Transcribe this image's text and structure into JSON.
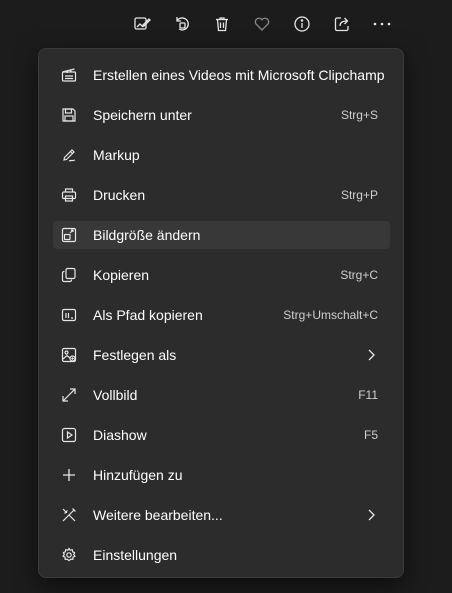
{
  "toolbar": {
    "buttons": [
      {
        "name": "edit-image-icon"
      },
      {
        "name": "rotate-icon"
      },
      {
        "name": "delete-icon"
      },
      {
        "name": "favorite-heart-icon"
      },
      {
        "name": "info-icon"
      },
      {
        "name": "share-icon"
      },
      {
        "name": "more-options-icon"
      }
    ]
  },
  "menu": {
    "items": [
      {
        "label": "Erstellen eines Videos mit Microsoft Clipchamp",
        "shortcut": "",
        "icon": "clipchamp-icon"
      },
      {
        "label": "Speichern unter",
        "shortcut": "Strg+S",
        "icon": "save-icon"
      },
      {
        "label": "Markup",
        "shortcut": "",
        "icon": "markup-pen-icon"
      },
      {
        "label": "Drucken",
        "shortcut": "Strg+P",
        "icon": "print-icon"
      },
      {
        "label": "Bildgröße ändern",
        "shortcut": "",
        "icon": "resize-image-icon"
      },
      {
        "label": "Kopieren",
        "shortcut": "Strg+C",
        "icon": "copy-icon"
      },
      {
        "label": "Als Pfad kopieren",
        "shortcut": "Strg+Umschalt+C",
        "icon": "copy-path-icon"
      },
      {
        "label": "Festlegen als",
        "shortcut": "",
        "icon": "set-as-icon"
      },
      {
        "label": "Vollbild",
        "shortcut": "F11",
        "icon": "fullscreen-icon"
      },
      {
        "label": "Diashow",
        "shortcut": "F5",
        "icon": "slideshow-icon"
      },
      {
        "label": "Hinzufügen zu",
        "shortcut": "",
        "icon": "add-icon"
      },
      {
        "label": "Weitere bearbeiten...",
        "shortcut": "",
        "icon": "more-edit-icon"
      },
      {
        "label": "Einstellungen",
        "shortcut": "",
        "icon": "settings-gear-icon"
      }
    ],
    "hovered_index": 4
  },
  "colors": {
    "background": "#1c1c1c",
    "menu_bg": "#2c2c2c",
    "hover_bg": "#383838",
    "text": "#ffffff",
    "shortcut_text": "#cfcfcf",
    "icon": "#e6e6e6",
    "icon_dim": "#8a8a8a"
  }
}
